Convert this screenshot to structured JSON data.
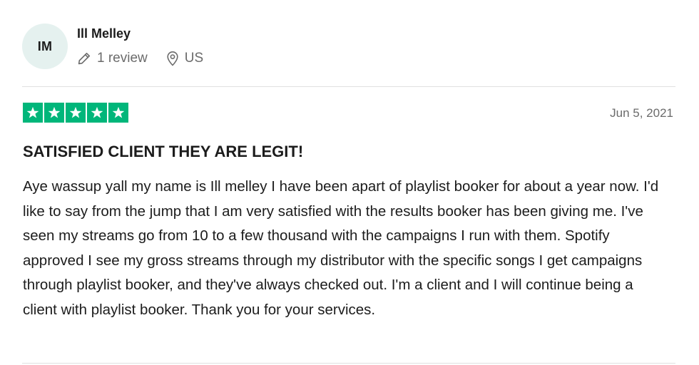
{
  "consumer": {
    "initials": "IM",
    "name": "Ill Melley",
    "review_count": "1 review",
    "location": "US"
  },
  "review": {
    "rating": 5,
    "rating_color": "#00b67a",
    "date": "Jun 5, 2021",
    "title": "SATISFIED CLIENT THEY ARE LEGIT!",
    "body": "Aye wassup yall my name is Ill melley I have been apart of playlist booker for about a year now. I'd like to say from the jump that I am very satisfied with the results booker has been giving me. I've seen my streams go from 10 to a few thousand with the campaigns I run with them. Spotify approved I see my gross streams through my distributor with the specific songs I get campaigns through playlist booker, and they've always checked out. I'm a client and I will continue being a client with playlist booker. Thank you for your services."
  },
  "icons": {
    "review_count": "pencil-icon",
    "location": "location-pin-icon",
    "star": "star-icon"
  }
}
